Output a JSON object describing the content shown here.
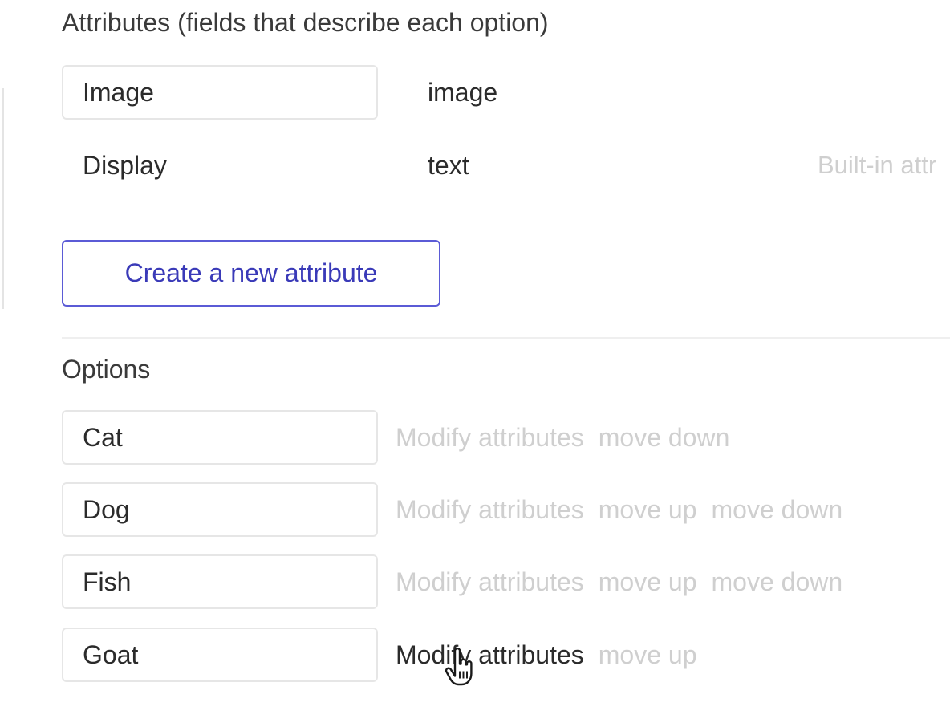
{
  "attributes": {
    "heading": "Attributes (fields that describe each option)",
    "items": [
      {
        "name": "Image",
        "type": "image",
        "note": ""
      },
      {
        "name": "Display",
        "type": "text",
        "note": "Built-in attr"
      }
    ],
    "create_button_label": "Create a new attribute"
  },
  "options": {
    "heading": "Options",
    "items": [
      {
        "name": "Cat",
        "modify_label": "Modify attributes",
        "move_up_label": "",
        "move_down_label": "move down"
      },
      {
        "name": "Dog",
        "modify_label": "Modify attributes",
        "move_up_label": "move up",
        "move_down_label": "move down"
      },
      {
        "name": "Fish",
        "modify_label": "Modify attributes",
        "move_up_label": "move up",
        "move_down_label": "move down"
      },
      {
        "name": "Goat",
        "modify_label": "Modify attributes",
        "move_up_label": "move up",
        "move_down_label": ""
      }
    ]
  },
  "colors": {
    "accent": "#5b5bd6",
    "muted_text": "#cfcfcf",
    "border": "#e6e6e6"
  },
  "icons": {
    "cursor": "hand-pointer-icon"
  }
}
